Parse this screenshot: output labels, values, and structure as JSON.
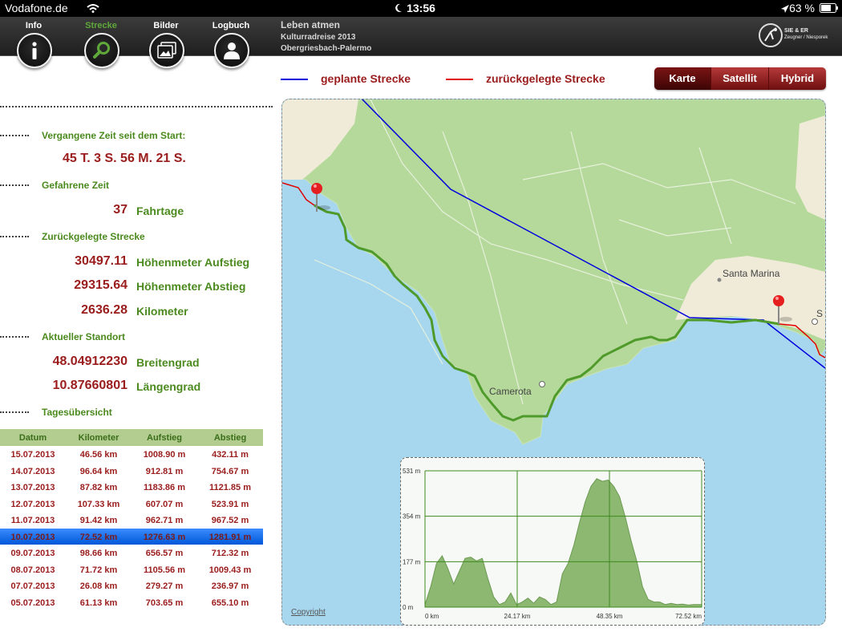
{
  "status": {
    "carrier": "Vodafone.de",
    "time": "13:56",
    "battery": "63 %"
  },
  "nav": [
    {
      "label": "Info",
      "icon": "info-icon"
    },
    {
      "label": "Strecke",
      "icon": "search-icon"
    },
    {
      "label": "Bilder",
      "icon": "photos-icon"
    },
    {
      "label": "Logbuch",
      "icon": "person-icon"
    }
  ],
  "trip": {
    "title": "Leben atmen",
    "subtitle": "Kulturradreise 2013",
    "route": "Obergriesbach-Palermo"
  },
  "logo": {
    "line1": "SIE & ER",
    "line2": "Zeugner / Niesporek"
  },
  "legend": {
    "planned": "geplante Strecke",
    "planned_color": "#0000dd",
    "traveled": "zurückgelegte Strecke",
    "traveled_color": "#e00000"
  },
  "maptype": {
    "options": [
      "Karte",
      "Satellit",
      "Hybrid"
    ],
    "selected": "Karte"
  },
  "stats": {
    "elapsed_label": "Vergangene Zeit seit dem Start:",
    "elapsed_value": "45 T. 3 S. 56 M. 21 S.",
    "driven_label": "Gefahrene Zeit",
    "days_value": "37",
    "days_unit": "Fahrtage",
    "distance_label": "Zurückgelegte Strecke",
    "ascent_value": "30497.11",
    "ascent_unit": "Höhenmeter Aufstieg",
    "descent_value": "29315.64",
    "descent_unit": "Höhenmeter Abstieg",
    "km_value": "2636.28",
    "km_unit": "Kilometer",
    "location_label": "Aktueller Standort",
    "lat_value": "48.04912230",
    "lat_unit": "Breitengrad",
    "lon_value": "10.87660801",
    "lon_unit": "Längengrad",
    "overview_label": "Tagesübersicht"
  },
  "table": {
    "headers": [
      "Datum",
      "Kilometer",
      "Aufstieg",
      "Abstieg"
    ],
    "selected_index": 5,
    "rows": [
      [
        "15.07.2013",
        "46.56 km",
        "1008.90 m",
        "432.11 m"
      ],
      [
        "14.07.2013",
        "96.64 km",
        "912.81 m",
        "754.67 m"
      ],
      [
        "13.07.2013",
        "87.82 km",
        "1183.86 m",
        "1121.85 m"
      ],
      [
        "12.07.2013",
        "107.33 km",
        "607.07 m",
        "523.91 m"
      ],
      [
        "11.07.2013",
        "91.42 km",
        "962.71 m",
        "967.52 m"
      ],
      [
        "10.07.2013",
        "72.52 km",
        "1276.63 m",
        "1281.91 m"
      ],
      [
        "09.07.2013",
        "98.66 km",
        "656.57 m",
        "712.32 m"
      ],
      [
        "08.07.2013",
        "71.72 km",
        "1105.56 m",
        "1009.43 m"
      ],
      [
        "07.07.2013",
        "26.08 km",
        "279.27 m",
        "236.97 m"
      ],
      [
        "05.07.2013",
        "61.13 km",
        "703.65 m",
        "655.10 m"
      ]
    ]
  },
  "map": {
    "places": [
      "Camerota",
      "Santa Marina",
      "S"
    ],
    "copyright": "Copyright",
    "land_color": "#b5d99a",
    "sea_color": "#a7d7ee",
    "beige_color": "#f0ebd9"
  },
  "chart_data": {
    "type": "area",
    "ytick_labels": [
      "531 m",
      "354 m",
      "177 m",
      "0 m"
    ],
    "xtick_labels": [
      "0 km",
      "24.17 km",
      "48.35 km",
      "72.52 km"
    ],
    "ylim": [
      0,
      531
    ],
    "xlim": [
      0,
      72.52
    ],
    "grid": true,
    "x": [
      0,
      1.5,
      3,
      4.5,
      6,
      7.5,
      9,
      10.5,
      12,
      13.5,
      15,
      16.5,
      18,
      19.5,
      21,
      22.5,
      24,
      25.5,
      27,
      28.5,
      30,
      31.5,
      33,
      34.5,
      36,
      37.5,
      39,
      40.5,
      42,
      43.5,
      45,
      46.5,
      48,
      49.5,
      51,
      52.5,
      54,
      55.5,
      57,
      58.5,
      60,
      61.5,
      63,
      64.5,
      66,
      67.5,
      69,
      70.5,
      72.52
    ],
    "y": [
      10,
      80,
      170,
      200,
      150,
      90,
      140,
      190,
      195,
      180,
      190,
      110,
      40,
      10,
      20,
      55,
      10,
      20,
      35,
      15,
      40,
      30,
      10,
      20,
      130,
      170,
      240,
      330,
      410,
      470,
      500,
      490,
      495,
      470,
      430,
      350,
      260,
      180,
      80,
      30,
      20,
      20,
      10,
      15,
      10,
      12,
      8,
      10,
      10
    ],
    "fill_color": "#8db872"
  }
}
